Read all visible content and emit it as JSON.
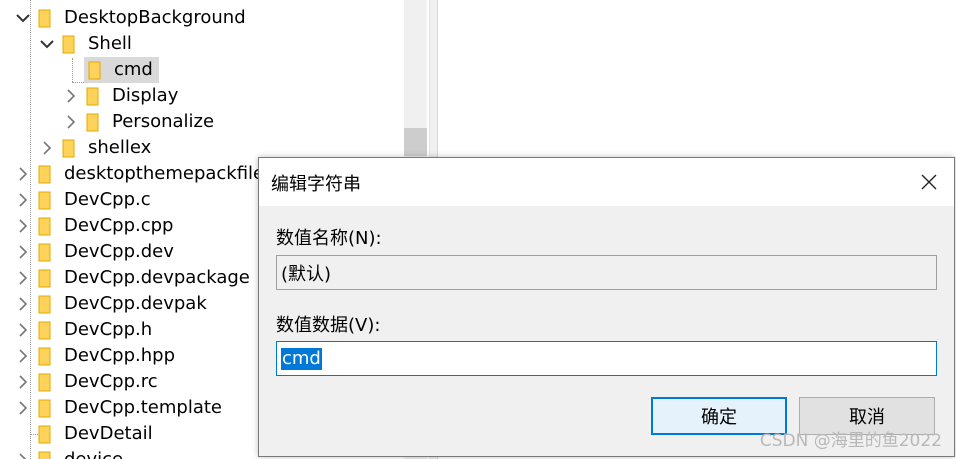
{
  "tree": {
    "top_partial_label": "DesktopBackground",
    "items": [
      {
        "label": "DesktopBackground",
        "expanded": true
      },
      {
        "label": "Shell",
        "expanded": true
      },
      {
        "label": "cmd",
        "selected": true
      },
      {
        "label": "Display",
        "expanded": false
      },
      {
        "label": "Personalize",
        "expanded": false
      },
      {
        "label": "shellex",
        "expanded": false
      },
      {
        "label": "desktopthemepackfile",
        "expanded": false
      },
      {
        "label": "DevCpp.c",
        "expanded": false
      },
      {
        "label": "DevCpp.cpp",
        "expanded": false
      },
      {
        "label": "DevCpp.dev",
        "expanded": false
      },
      {
        "label": "DevCpp.devpackage",
        "expanded": false
      },
      {
        "label": "DevCpp.devpak",
        "expanded": false
      },
      {
        "label": "DevCpp.h",
        "expanded": false
      },
      {
        "label": "DevCpp.hpp",
        "expanded": false
      },
      {
        "label": "DevCpp.rc",
        "expanded": false
      },
      {
        "label": "DevCpp.template",
        "expanded": false
      },
      {
        "label": "DevDetail"
      },
      {
        "label": "device",
        "expanded": false
      }
    ]
  },
  "dialog": {
    "title": "编辑字符串",
    "name_label": "数值名称(N):",
    "name_value": "(默认)",
    "data_label": "数值数据(V):",
    "data_value": "cmd",
    "ok_label": "确定",
    "cancel_label": "取消"
  },
  "watermark": "CSDN @海里的鱼2022",
  "colors": {
    "folder": "#ffd35a",
    "accent": "#0078d7",
    "selection_bg": "#d9d9d9"
  }
}
